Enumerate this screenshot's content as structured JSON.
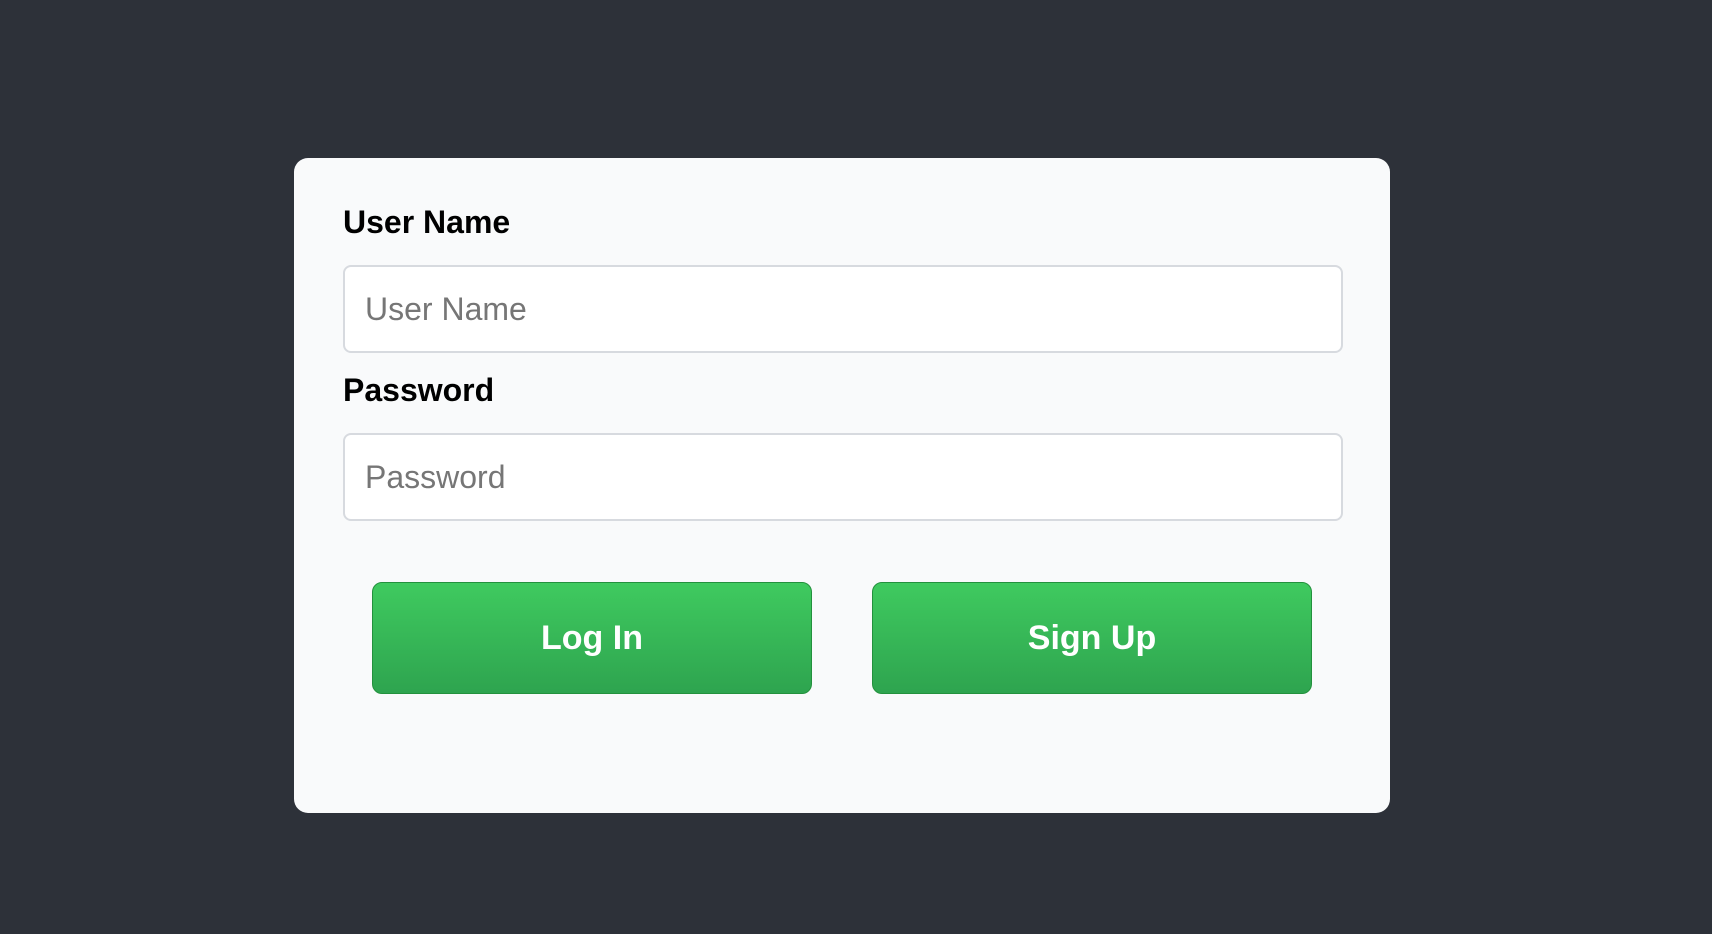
{
  "login_form": {
    "username": {
      "label": "User Name",
      "value": "",
      "placeholder": "User Name"
    },
    "password": {
      "label": "Password",
      "value": "",
      "placeholder": "Password"
    },
    "buttons": {
      "login_label": "Log In",
      "signup_label": "Sign Up"
    }
  },
  "colors": {
    "page_background": "#2d3139",
    "card_background": "#f9fafb",
    "button_green_top": "#3fca5f",
    "button_green_bottom": "#2ea44f",
    "button_text": "#ffffff"
  }
}
